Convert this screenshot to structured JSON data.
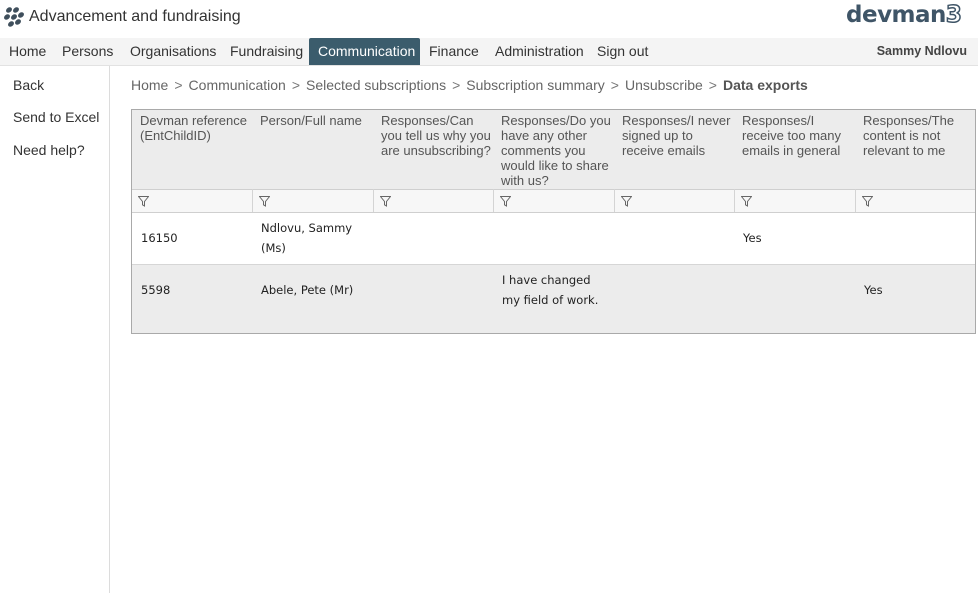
{
  "app": {
    "title": "Advancement and fundraising",
    "logo_text": "devman",
    "logo_number": "3"
  },
  "nav": {
    "items": [
      {
        "label": "Home"
      },
      {
        "label": "Persons"
      },
      {
        "label": "Organisations"
      },
      {
        "label": "Fundraising"
      },
      {
        "label": "Communication",
        "active": true
      },
      {
        "label": "Finance"
      },
      {
        "label": "Administration"
      },
      {
        "label": "Sign out"
      }
    ],
    "user": "Sammy Ndlovu"
  },
  "sidebar": {
    "items": [
      {
        "label": "Back"
      },
      {
        "label": "Send to Excel"
      },
      {
        "label": "Need help?"
      }
    ]
  },
  "breadcrumb": {
    "separator": ">",
    "items": [
      "Home",
      "Communication",
      "Selected subscriptions",
      "Subscription summary",
      "Unsubscribe"
    ],
    "current": "Data exports"
  },
  "grid": {
    "columns": [
      "Devman reference (EntChildID)",
      "Person/Full name",
      "Responses/Can you tell us why you are unsubscribing?",
      "Responses/Do you have any other comments you would like to share with us?",
      "Responses/I never signed up to receive emails",
      "Responses/I receive too many emails in general",
      "Responses/The content is not relevant to me"
    ],
    "rows": [
      [
        "16150",
        "Ndlovu, Sammy (Ms)",
        "",
        "",
        "",
        "Yes",
        ""
      ],
      [
        "5598",
        "Abele, Pete (Mr)",
        "",
        "I have changed my field of work.",
        "",
        "",
        "Yes"
      ]
    ]
  },
  "colors": {
    "nav_active": "#3b5c6c",
    "logo": "#3f5567"
  }
}
